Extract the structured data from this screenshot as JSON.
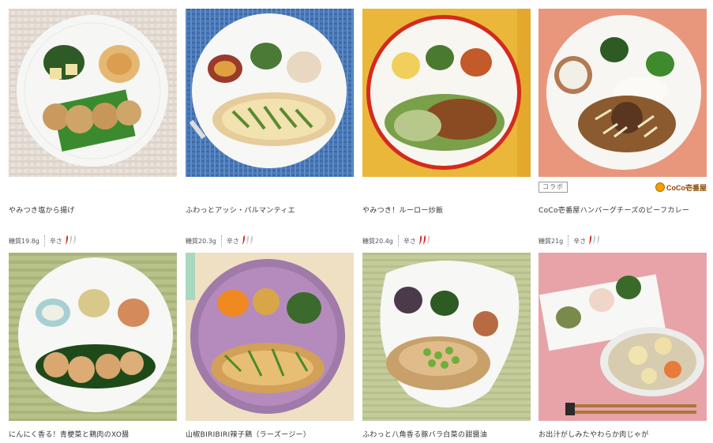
{
  "products": [
    {
      "title": "やみつき塩から揚げ",
      "sugar": "糖質19.8g",
      "spice_label": "辛さ",
      "spice_level": 1,
      "spice_max": 3,
      "collab": null,
      "brand": null
    },
    {
      "title": "ふわっとアッシ・パルマンティエ",
      "sugar": "糖質20.3g",
      "spice_label": "辛さ",
      "spice_level": 1,
      "spice_max": 3,
      "collab": null,
      "brand": null
    },
    {
      "title": "やみつき！ルーロー炒飯",
      "sugar": "糖質20.4g",
      "spice_label": "辛さ",
      "spice_level": 2,
      "spice_max": 3,
      "collab": null,
      "brand": null
    },
    {
      "title": "CoCo壱番屋ハンバーグチーズのビーフカレー",
      "sugar": "糖質21g",
      "spice_label": "辛さ",
      "spice_level": 1,
      "spice_max": 3,
      "collab": "コラボ",
      "brand": "CoCo壱番屋"
    },
    {
      "title": "にんにく香る！青梗菜と鶏肉のXO醤",
      "sugar": null,
      "spice_label": null,
      "collab": null,
      "brand": null
    },
    {
      "title": "山椒BIRIBIRI辣子鶏（ラーズージー）",
      "sugar": null,
      "spice_label": null,
      "collab": null,
      "brand": null
    },
    {
      "title": "ふわっと八角香る豚バラ白菜の甜醤油",
      "sugar": null,
      "spice_label": null,
      "collab": null,
      "brand": null
    },
    {
      "title": "お出汁がしみたやわらか肉じゃが",
      "sugar": null,
      "spice_label": null,
      "collab": null,
      "brand": null
    }
  ],
  "colors": {
    "chili_active": "#d42a1e",
    "chili_inactive": "#c8c8c8",
    "text": "#333333"
  }
}
